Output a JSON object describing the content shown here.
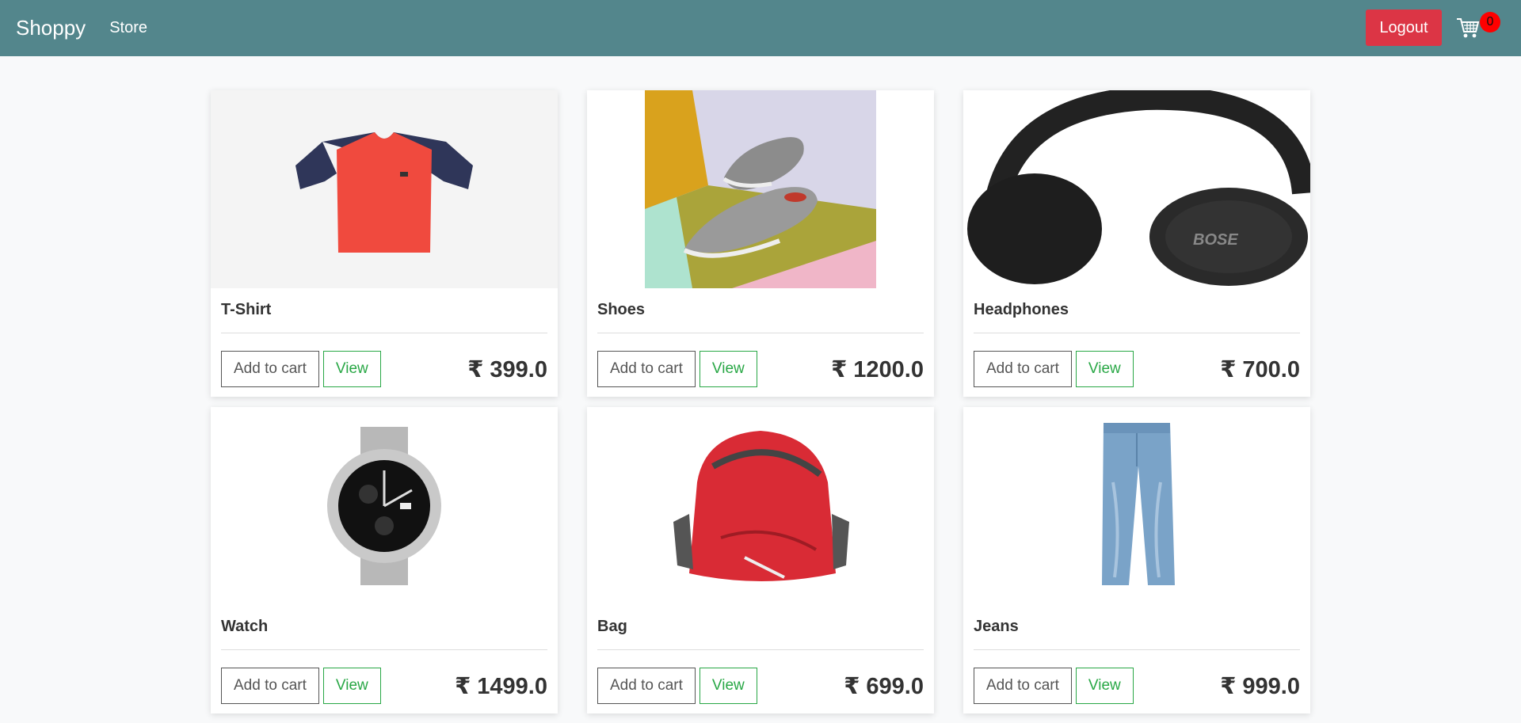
{
  "navbar": {
    "brand": "Shoppy",
    "links": [
      {
        "label": "Store"
      }
    ],
    "logout_label": "Logout",
    "cart_count": "0",
    "color": "#53868c",
    "logout_color": "#dc3545"
  },
  "products": [
    {
      "title": "T-Shirt",
      "price": "₹ 399.0",
      "add_label": "Add to cart",
      "view_label": "View",
      "image": "t-shirt-image"
    },
    {
      "title": "Shoes",
      "price": "₹ 1200.0",
      "add_label": "Add to cart",
      "view_label": "View",
      "image": "shoes-image"
    },
    {
      "title": "Headphones",
      "price": "₹ 700.0",
      "add_label": "Add to cart",
      "view_label": "View",
      "image": "headphones-image"
    },
    {
      "title": "Watch",
      "price": "₹ 1499.0",
      "add_label": "Add to cart",
      "view_label": "View",
      "image": "watch-image"
    },
    {
      "title": "Bag",
      "price": "₹ 699.0",
      "add_label": "Add to cart",
      "view_label": "View",
      "image": "bag-image"
    },
    {
      "title": "Jeans",
      "price": "₹ 999.0",
      "add_label": "Add to cart",
      "view_label": "View",
      "image": "jeans-image"
    }
  ]
}
